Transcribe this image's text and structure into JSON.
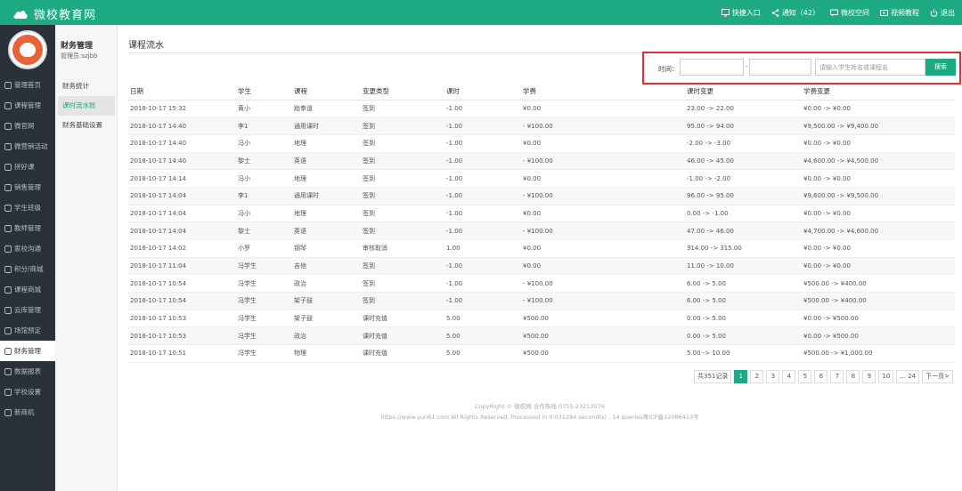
{
  "brand": {
    "name": "微校教育网"
  },
  "topnav": [
    {
      "label": "快捷入口",
      "icon": "monitor-icon"
    },
    {
      "label": "通知（42）",
      "icon": "share-icon"
    },
    {
      "label": "微校空间",
      "icon": "chat-icon"
    },
    {
      "label": "视频教程",
      "icon": "video-icon"
    },
    {
      "label": "退出",
      "icon": "power-icon"
    }
  ],
  "sidebar": {
    "items": [
      {
        "label": "管理首页",
        "icon": "home-icon"
      },
      {
        "label": "课程管理",
        "icon": "book-icon"
      },
      {
        "label": "微官网",
        "icon": "globe-icon"
      },
      {
        "label": "微营销活动",
        "icon": "gift-icon"
      },
      {
        "label": "拼好课",
        "icon": "headset-icon"
      },
      {
        "label": "销售管理",
        "icon": "user-icon"
      },
      {
        "label": "学生班级",
        "icon": "id-card-icon"
      },
      {
        "label": "教师管理",
        "icon": "teacher-icon"
      },
      {
        "label": "家校沟通",
        "icon": "message-icon"
      },
      {
        "label": "积分/商城",
        "icon": "cart-icon"
      },
      {
        "label": "课程商城",
        "icon": "store-icon"
      },
      {
        "label": "云库管理",
        "icon": "cloud-icon"
      },
      {
        "label": "场馆预定",
        "icon": "calendar-icon"
      },
      {
        "label": "财务管理",
        "icon": "wallet-icon",
        "active": true
      },
      {
        "label": "数据报表",
        "icon": "chart-icon"
      },
      {
        "label": "学校设置",
        "icon": "settings-icon"
      },
      {
        "label": "新商机",
        "icon": "target-icon"
      }
    ]
  },
  "subside": {
    "title": "财务管理",
    "admin": "管理员:szjbb",
    "items": [
      {
        "label": "财务统计"
      },
      {
        "label": "课时流水账",
        "active": true
      },
      {
        "label": "财务基础设置"
      }
    ]
  },
  "page": {
    "title": "课程流水",
    "search": {
      "time_label": "时间：",
      "start_value": "",
      "sep": "-",
      "end_value": "",
      "keyword_placeholder": "请输入学生姓名或课程名",
      "button": "搜索"
    }
  },
  "table": {
    "columns": [
      "日期",
      "学生",
      "课程",
      "变更类型",
      "课时",
      "学费",
      "课时变更",
      "学费变更"
    ],
    "rows": [
      [
        "2018-10-17 15:32",
        "黄小",
        "跆拳道",
        "签到",
        "-1.00",
        "¥0.00",
        "23.00 -> 22.00",
        "¥0.00 -> ¥0.00"
      ],
      [
        "2018-10-17 14:40",
        "李1",
        "通用课时",
        "签到",
        "-1.00",
        "- ¥100.00",
        "95.00 -> 94.00",
        "¥9,500.00 -> ¥9,400.00"
      ],
      [
        "2018-10-17 14:40",
        "冯小",
        "地理",
        "签到",
        "-1.00",
        "¥0.00",
        "-2.00 -> -3.00",
        "¥0.00 -> ¥0.00"
      ],
      [
        "2018-10-17 14:40",
        "黎士",
        "英语",
        "签到",
        "-1.00",
        "- ¥100.00",
        "46.00 -> 45.00",
        "¥4,600.00 -> ¥4,500.00"
      ],
      [
        "2018-10-17 14:14",
        "冯小",
        "地理",
        "签到",
        "-1.00",
        "¥0.00",
        "-1.00 -> -2.00",
        "¥0.00 -> ¥0.00"
      ],
      [
        "2018-10-17 14:04",
        "李1",
        "通用课时",
        "签到",
        "-1.00",
        "- ¥100.00",
        "96.00 -> 95.00",
        "¥9,600.00 -> ¥9,500.00"
      ],
      [
        "2018-10-17 14:04",
        "冯小",
        "地理",
        "签到",
        "-1.00",
        "¥0.00",
        "0.00 -> -1.00",
        "¥0.00 -> ¥0.00"
      ],
      [
        "2018-10-17 14:04",
        "黎士",
        "英语",
        "签到",
        "-1.00",
        "- ¥100.00",
        "47.00 -> 46.00",
        "¥4,700.00 -> ¥4,600.00"
      ],
      [
        "2018-10-17 14:02",
        "小罗",
        "钢琴",
        "审核取消",
        "1.00",
        "¥0.00",
        "314.00 -> 315.00",
        "¥0.00 -> ¥0.00"
      ],
      [
        "2018-10-17 11:04",
        "冯学生",
        "吉他",
        "签到",
        "-1.00",
        "¥0.00",
        "11.00 -> 10.00",
        "¥0.00 -> ¥0.00"
      ],
      [
        "2018-10-17 10:54",
        "冯学生",
        "政治",
        "签到",
        "-1.00",
        "- ¥100.00",
        "6.00 -> 5.00",
        "¥500.00 -> ¥400.00"
      ],
      [
        "2018-10-17 10:54",
        "冯学生",
        "架子鼓",
        "签到",
        "-1.00",
        "- ¥100.00",
        "6.00 -> 5.00",
        "¥500.00 -> ¥400.00"
      ],
      [
        "2018-10-17 10:53",
        "冯学生",
        "架子鼓",
        "课时充值",
        "5.00",
        "¥500.00",
        "0.00 -> 5.00",
        "¥0.00 -> ¥500.00"
      ],
      [
        "2018-10-17 10:53",
        "冯学生",
        "政治",
        "课时充值",
        "5.00",
        "¥500.00",
        "0.00 -> 5.00",
        "¥0.00 -> ¥500.00"
      ],
      [
        "2018-10-17 10:51",
        "冯学生",
        "物理",
        "课时充值",
        "5.00",
        "¥500.00",
        "5.00 -> 10.00",
        "¥500.00 -> ¥1,000.00"
      ]
    ]
  },
  "pager": {
    "total": "共351记录",
    "pages": [
      "1",
      "2",
      "3",
      "4",
      "5",
      "6",
      "7",
      "8",
      "9",
      "10",
      "... 24"
    ],
    "current": "1",
    "next": "下一页>"
  },
  "footer": {
    "line1": "CopyRight © 微校网 合作热线:0755-23213576",
    "line2": "https://www.yun61.com All Rights Reserved. Processed in 0.031284 second(s) , 14 queries粤ICP备12086413号"
  },
  "colors": {
    "brand": "#1eaa83",
    "sidebar": "#2a3138",
    "highlight": "#e03030"
  }
}
